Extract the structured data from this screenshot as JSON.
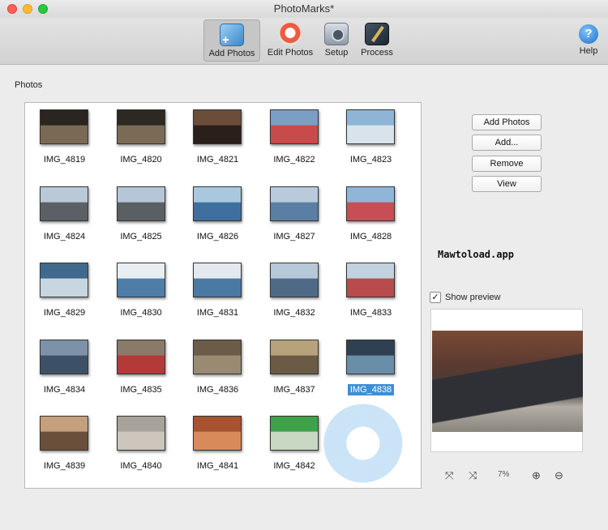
{
  "window": {
    "title": "PhotoMarks*"
  },
  "toolbar": {
    "add_photos": "Add Photos",
    "edit_photos": "Edit Photos",
    "setup": "Setup",
    "process": "Process",
    "help": "Help",
    "help_glyph": "?"
  },
  "photos_label": "Photos",
  "photos": [
    {
      "name": "IMG_4819",
      "c1": "#2a2520",
      "c2": "#7a6a55"
    },
    {
      "name": "IMG_4820",
      "c1": "#2c2822",
      "c2": "#7b6b56"
    },
    {
      "name": "IMG_4821",
      "c1": "#6b4d3a",
      "c2": "#2a1f1a"
    },
    {
      "name": "IMG_4822",
      "c1": "#7a9ec4",
      "c2": "#c94a4a"
    },
    {
      "name": "IMG_4823",
      "c1": "#8fb5d6",
      "c2": "#d8e3ea"
    },
    {
      "name": "IMG_4824",
      "c1": "#b9c9d8",
      "c2": "#5c6066"
    },
    {
      "name": "IMG_4825",
      "c1": "#b5c6d6",
      "c2": "#5a5f63"
    },
    {
      "name": "IMG_4826",
      "c1": "#a8c8e0",
      "c2": "#3f6f9e"
    },
    {
      "name": "IMG_4827",
      "c1": "#b8cadb",
      "c2": "#5b7fa4"
    },
    {
      "name": "IMG_4828",
      "c1": "#8fb6d8",
      "c2": "#c94d55"
    },
    {
      "name": "IMG_4829",
      "c1": "#3f6a8e",
      "c2": "#c8d6e2"
    },
    {
      "name": "IMG_4830",
      "c1": "#e9eef2",
      "c2": "#4e7ea8"
    },
    {
      "name": "IMG_4831",
      "c1": "#e3e9ee",
      "c2": "#4a79a3"
    },
    {
      "name": "IMG_4832",
      "c1": "#b7c8d8",
      "c2": "#4e6a86"
    },
    {
      "name": "IMG_4833",
      "c1": "#c2d2df",
      "c2": "#b84b4b"
    },
    {
      "name": "IMG_4834",
      "c1": "#7d92a8",
      "c2": "#3d5166"
    },
    {
      "name": "IMG_4835",
      "c1": "#8a7a6a",
      "c2": "#b43a3a"
    },
    {
      "name": "IMG_4836",
      "c1": "#6d5b49",
      "c2": "#9a8a72"
    },
    {
      "name": "IMG_4837",
      "c1": "#b8a27c",
      "c2": "#6b5a44"
    },
    {
      "name": "IMG_4838",
      "c1": "#2f4050",
      "c2": "#6a8da8",
      "selected": true
    },
    {
      "name": "IMG_4839",
      "c1": "#c4a07c",
      "c2": "#6a4f3a"
    },
    {
      "name": "IMG_4840",
      "c1": "#a8a39a",
      "c2": "#ccc6bd"
    },
    {
      "name": "IMG_4841",
      "c1": "#a6532f",
      "c2": "#d98a5a"
    },
    {
      "name": "IMG_4842",
      "c1": "#3fa14a",
      "c2": "#c9d8c2"
    }
  ],
  "side_buttons": {
    "add_photos": "Add Photos",
    "add": "Add...",
    "remove": "Remove",
    "view": "View"
  },
  "watermark_text": "Mawtoload.app",
  "preview": {
    "checked": true,
    "check_glyph": "✓",
    "label": "Show preview",
    "zoom_percent": "7%",
    "fit_glyph": "⤧",
    "actual_glyph": "⤨",
    "zoom_in_glyph": "⊕",
    "zoom_out_glyph": "⊖"
  }
}
